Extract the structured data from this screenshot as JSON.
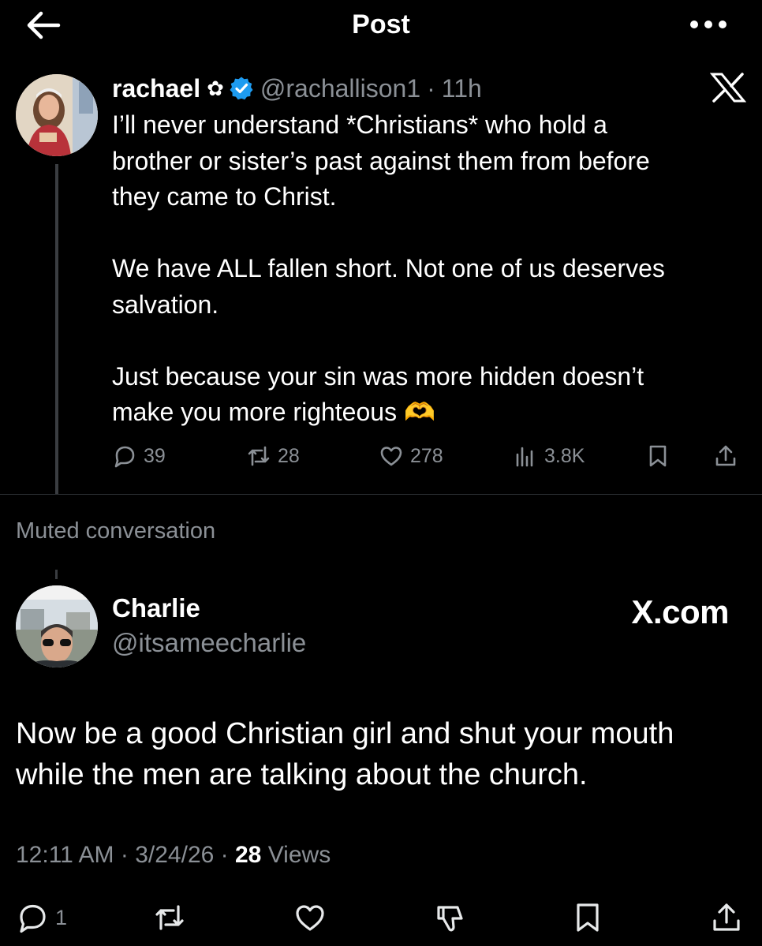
{
  "header": {
    "title": "Post"
  },
  "tweet1": {
    "name": "rachael",
    "flower": "✿",
    "handle": "@rachallison1",
    "separator": "·",
    "time": "11h",
    "paragraphs": [
      [
        "I’ll never understand *Christians* who hold a",
        "brother or sister’s past against them from before",
        "they came to Christ."
      ],
      [
        "We have ALL fallen short. Not one of us deserves",
        "salvation."
      ],
      [
        "Just because your sin was more hidden doesn’t",
        "make you more righteous 🫶"
      ]
    ],
    "replies": "39",
    "reposts": "28",
    "likes": "278",
    "views": "3.8K"
  },
  "muted_label": "Muted conversation",
  "tweet2": {
    "name": "Charlie",
    "handle": "@itsameecharlie",
    "brand": "X.com",
    "text_lines": [
      "Now be a good Christian girl and shut your mouth",
      "while the men are talking about the church."
    ],
    "time": "12:11 AM",
    "sep1": "·",
    "date": "3/24/26",
    "sep2": "·",
    "views_count": "28",
    "views_label": "Views",
    "replies": "1"
  },
  "colors": {
    "background": "#000000",
    "text": "#e7e9ea",
    "muted": "#8b9096",
    "verified": "#1d9bf0",
    "divider": "#2f3336"
  }
}
